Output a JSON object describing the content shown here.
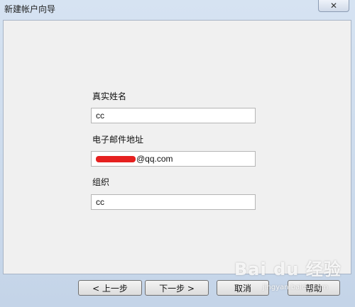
{
  "window": {
    "title": "新建帐户向导",
    "close_glyph": "✕"
  },
  "form": {
    "name_label": "真实姓名",
    "name_value": "cc",
    "email_label": "电子邮件地址",
    "email_value": "@qq.com",
    "org_label": "组织",
    "org_value": "cc"
  },
  "buttons": {
    "prev": "< 上一步",
    "next": "下一步 >",
    "cancel": "取消",
    "help": "帮助"
  },
  "watermark": {
    "brand": "Bai du 经验",
    "url": "jingyan.baidu.com"
  },
  "colors": {
    "redaction": "#e5201f"
  }
}
